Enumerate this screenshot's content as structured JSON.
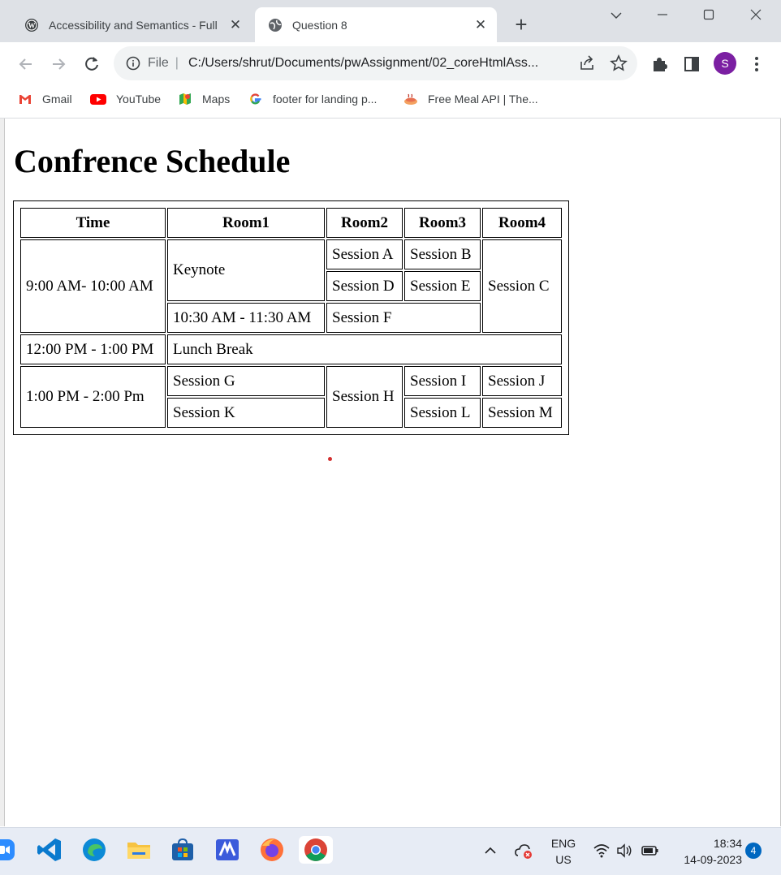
{
  "browser": {
    "tabs": [
      {
        "title": "Accessibility and Semantics - Full",
        "active": false
      },
      {
        "title": "Question 8",
        "active": true
      }
    ],
    "omnibox": {
      "scheme": "File",
      "url": "C:/Users/shrut/Documents/pwAssignment/02_coreHtmlAss..."
    },
    "profile_initial": "S",
    "bookmarks": [
      {
        "label": "Gmail",
        "icon": "gmail-icon"
      },
      {
        "label": "YouTube",
        "icon": "youtube-icon"
      },
      {
        "label": "Maps",
        "icon": "maps-icon"
      },
      {
        "label": "footer for landing p...",
        "icon": "google-icon"
      },
      {
        "label": "Free Meal API | The...",
        "icon": "meal-icon"
      }
    ],
    "colors": {
      "tabstrip": "#dee1e6",
      "omnibox": "#f1f3f4",
      "avatar": "#7b1fa2"
    }
  },
  "page": {
    "title": "Confrence Schedule",
    "table": {
      "headers": [
        "Time",
        "Room1",
        "Room2",
        "Room3",
        "Room4"
      ],
      "time1": "9:00 AM- 10:00 AM",
      "keynote": "Keynote",
      "session_a": "Session A",
      "session_b": "Session B",
      "session_c": "Session C",
      "session_d": "Session D",
      "session_e": "Session E",
      "time_1030": "10:30 AM - 11:30 AM",
      "session_f": "Session F",
      "time_lunch": "12:00 PM - 1:00 PM",
      "lunch": "Lunch Break",
      "time3": "1:00 PM - 2:00 Pm",
      "session_g": "Session G",
      "session_h": "Session H",
      "session_i": "Session I",
      "session_j": "Session J",
      "session_k": "Session K",
      "session_l": "Session L",
      "session_m": "Session M"
    }
  },
  "taskbar": {
    "apps": [
      "zoom-icon",
      "vscode-icon",
      "edge-icon",
      "file-explorer-icon",
      "store-icon",
      "app-icon",
      "firefox-icon",
      "chrome-icon"
    ],
    "language": "ENG",
    "region": "US",
    "time": "18:34",
    "date": "14-09-2023",
    "notifications": "4"
  }
}
